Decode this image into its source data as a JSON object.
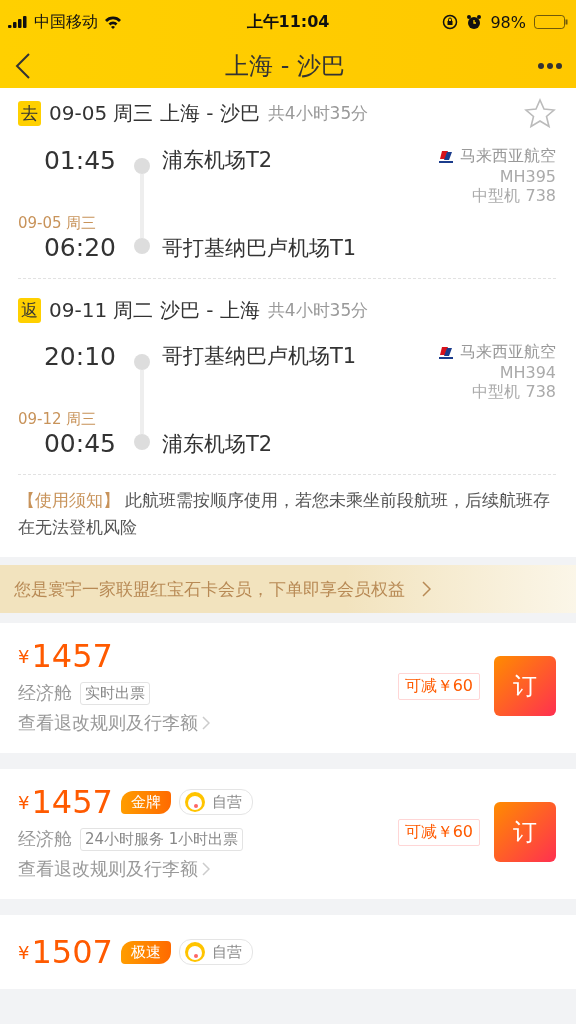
{
  "status_bar": {
    "carrier": "中国移动",
    "time": "上午11:04",
    "battery": "98%"
  },
  "nav": {
    "title": "上海 - 沙巴"
  },
  "legs": [
    {
      "tag": "去",
      "date": "09-05 周三 上海 - 沙巴",
      "duration": "共4小时35分",
      "dep_time": "01:45",
      "dep_airport": "浦东机场T2",
      "arr_date": "09-05 周三",
      "arr_time": "06:20",
      "arr_airport": "哥打基纳巴卢机场T1",
      "airline": "马来西亚航空",
      "flight": "MH395",
      "aircraft": "中型机 738"
    },
    {
      "tag": "返",
      "date": "09-11 周二 沙巴 - 上海",
      "duration": "共4小时35分",
      "dep_time": "20:10",
      "dep_airport": "哥打基纳巴卢机场T1",
      "arr_date": "09-12 周三",
      "arr_time": "00:45",
      "arr_airport": "浦东机场T2",
      "airline": "马来西亚航空",
      "flight": "MH394",
      "aircraft": "中型机 738"
    }
  ],
  "notice": {
    "label": "【使用须知】",
    "text": "此航班需按顺序使用，若您未乘坐前段航班，后续航班存在无法登机风险"
  },
  "member_banner": {
    "text": "您是寰宇一家联盟红宝石卡会员，下单即享会员权益"
  },
  "offers": [
    {
      "currency": "¥",
      "price": "1457",
      "cabin": "经济舱",
      "tag": "实时出票",
      "rules": "查看退改规则及行李额",
      "discount": "可减￥60",
      "book": "订"
    },
    {
      "currency": "¥",
      "price": "1457",
      "badges": [
        {
          "kind": "gold",
          "label": "金牌"
        },
        {
          "kind": "self",
          "label": "自营"
        }
      ],
      "cabin": "经济舱",
      "tag": "24小时服务 1小时出票",
      "rules": "查看退改规则及行李额",
      "discount": "可减￥60",
      "book": "订"
    },
    {
      "currency": "¥",
      "price": "1507",
      "badges": [
        {
          "kind": "gold",
          "label": "极速"
        },
        {
          "kind": "self",
          "label": "自营"
        }
      ]
    }
  ]
}
